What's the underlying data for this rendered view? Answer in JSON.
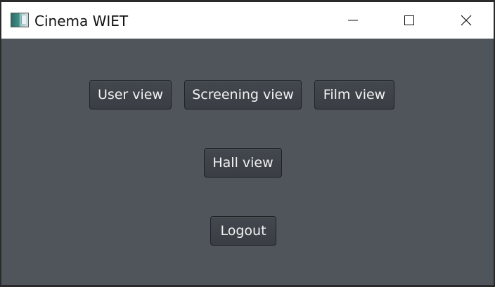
{
  "window": {
    "title": "Cinema WIET",
    "app_icon": "cinema-app-icon",
    "controls": {
      "minimize_icon": "minimize-icon",
      "maximize_icon": "maximize-icon",
      "close_icon": "close-icon"
    }
  },
  "main": {
    "buttons": {
      "user_view": "User view",
      "screening_view": "Screening view",
      "film_view": "Film view",
      "hall_view": "Hall view",
      "logout": "Logout"
    }
  },
  "colors": {
    "background": "#50555c",
    "button": "#3d4247",
    "button_text": "#f2f2f2",
    "titlebar": "#ffffff"
  }
}
